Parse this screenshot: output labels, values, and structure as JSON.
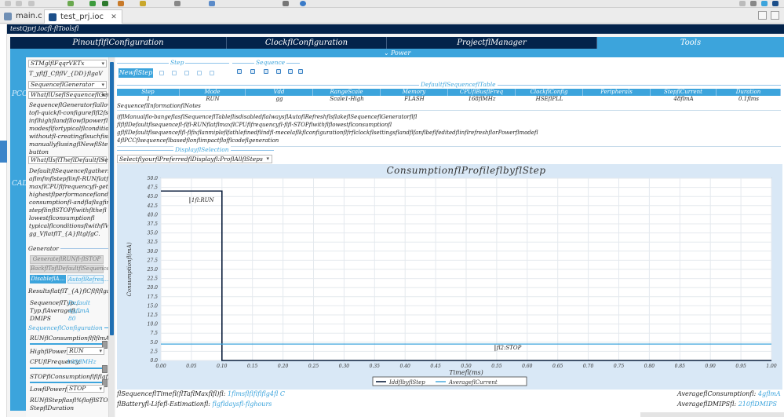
{
  "editor_tabs": [
    {
      "label": "main.c",
      "active": false
    },
    {
      "label": "test_prj.ioc",
      "active": true
    }
  ],
  "ioc_title": "testQprj.iocfl-flToolsfl",
  "main_tabs": [
    "PinoutflflConfiguration",
    "ClockflConfiguration",
    "ProjectflManager",
    "Tools"
  ],
  "power_label": "⌄ Power",
  "categories": [
    "PCC",
    "CAD"
  ],
  "left_panel": {
    "mcu_select": "STMglflFqqrVETx",
    "voltage_label": "T_yflfJ_CflflV_{DD}flgaV",
    "generator_select": "SequenceflGenerator",
    "what_select": "WhatflUseflSequenceflGener…",
    "gen_desc": [
      "SequenceflGeneratorflallowsfl",
      "tofl-quickfl-configureflfl2fsteps:",
      "inflhighflandfllowflpowerfl",
      "modesflfortypicalflconditionsfl",
      "withoutfl-creatingflsuchfistepsfl",
      "manuallyflusingflNewflStepfl",
      "button"
    ],
    "what_default_select": "WhatflIsflTheflDefaultflSequ…",
    "default_desc": [
      "DefaultflSequenceflgathersfl",
      "aflmfmflstepflinfl-RUNflatflhe",
      "maxflCPUflfrequencyfl-gettingfl",
      "highestflperformanceflandfl",
      "consumptionfl-andflaflsgfimstefl",
      "stepflinflSTOPflwithflthefl",
      "lowestflconsumptionfl",
      "typicalflconditionsflwithflV_{DD}fl",
      "gg_VflatflT_{A}fltglfgC."
    ],
    "generator_group": "Generator",
    "btn_generate": "GenerateflRUNfl-flSTOP",
    "btn_back": "BackflToflDefaultflSequence",
    "btn_disable": "DisableflA…",
    "btn_auto": "AutoflRefres…",
    "results_group": "ResultsflatflT_{A}flCflflflgaV…",
    "results": [
      {
        "label": "SequenceflTyp…",
        "value": "Default"
      },
      {
        "label": "Typ.flAveragefl…",
        "value": "4gflmA"
      },
      {
        "label": "DMIPS",
        "value": "80"
      }
    ],
    "seqconf_group": "SequenceflConfiguration",
    "run_consumption": "RUNflConsumptionflflflmA",
    "high_power_label": "HighflPowerflM…",
    "high_power_value": "RUN",
    "cpu_freq_label": "CPUflFrequency:",
    "cpu_freq_value": "168flMHz",
    "stop_consumption": "STOPflConsumptionflflflgfflA",
    "low_power_label": "LowflPowerflM…",
    "low_power_value": "STOP",
    "run_stop_ratio": "RUNflStepflasfl%flofflSTOPfl",
    "step_duration": "StepflDuration"
  },
  "step_section": "Step",
  "sequence_section": "Sequence",
  "new_step_button": "NewflStep",
  "default_table_title": "DefaultflSequenceflTable",
  "table": {
    "headers": [
      "Step",
      "Mode",
      "Vdd",
      "RangeScale",
      "Memory",
      "CPUflBusflFreq",
      "ClockflConfig",
      "Peripherals",
      "StepflCurrent",
      "Duration"
    ],
    "row": [
      "1",
      "RUN",
      "gg",
      "Scale1-High",
      "FLASH",
      "168flMHz",
      "HSEflPLL",
      "",
      "48flmA",
      "0.1flms"
    ]
  },
  "seq_info_label": "SequenceflInformationflNotes",
  "info_lines": [
    "ifflManualflo-bangeflasflSequenceflTableflisdisabledflalwaysflAutoflRefreshflsflakeflSequenceflGeneratorflfl",
    "flflflDefaultflsequencefl-flfl-RUNflatflmaxflCPUflfrequencyfl-flfl-STOPflwithflflowestflconsumptionfl",
    "gflflDefaultflsequenceflfl-flfixflanmipleflfathlefinedflindfl-mecelaflkflconfigurationflfrflclockflsettingsflandflfanflbeflfeditedflinflrefreshflorPowerflmodefl",
    "4flPCCflsequenceflbasedflonflimpactflofflcodeflgeneration"
  ],
  "display_section": "DisplayflSelection",
  "display_select": "SelectflyourflPreferredflDisplayfl:ProflAllflSteps",
  "chart_data": {
    "type": "line",
    "title": "ConsumptionflProfileflbyflStep",
    "xlabel": "Timefl(ms)",
    "ylabel": "Consumptionfl(mA)",
    "xlim": [
      0.0,
      1.0
    ],
    "ylim": [
      0.0,
      50.0
    ],
    "x_ticks": [
      "0.00",
      "0.05",
      "0.10",
      "0.15",
      "0.20",
      "0.25",
      "0.30",
      "0.35",
      "0.40",
      "0.45",
      "0.50",
      "0.55",
      "0.60",
      "0.65",
      "0.70",
      "0.75",
      "0.80",
      "0.85",
      "0.90",
      "0.95",
      "1.00"
    ],
    "y_ticks": [
      "0.0",
      "2.5",
      "5.0",
      "7.5",
      "10.0",
      "12.5",
      "15.0",
      "17.5",
      "20.0",
      "22.5",
      "25.0",
      "27.5",
      "30.0",
      "32.5",
      "35.0",
      "37.5",
      "40.0",
      "42.5",
      "45.0",
      "47.5",
      "50.0"
    ],
    "series": [
      {
        "name": "IddflbyflStep",
        "color": "#0b1e3c",
        "points": [
          [
            0.0,
            46.5
          ],
          [
            0.1,
            46.5
          ],
          [
            0.1,
            0.0
          ],
          [
            1.0,
            0.0
          ]
        ]
      },
      {
        "name": "AverageflCurrent",
        "color": "#3ca4dc",
        "points": [
          [
            0.0,
            4.5
          ],
          [
            1.0,
            4.5
          ]
        ]
      }
    ],
    "annotations": [
      {
        "text": "1fl:RUN",
        "x": 0.05,
        "y": 43.5
      },
      {
        "text": "fl2:STOP",
        "x": 0.55,
        "y": 3.0
      }
    ],
    "legend_position": "bottom",
    "grid": true
  },
  "stats": {
    "seq_time_label": "flSequenceflTimefl(flTaflMaxflfl)fl:",
    "seq_time_value": "1flmsflflflflflg4fl C",
    "battery_label": "flBatteryfl-Lifefl-Estimationfl:",
    "battery_value": "flgfldaysfl-flghours",
    "avg_consumption_label": "AverageflConsumptionfl:",
    "avg_consumption_value": "4gflmA",
    "avg_dmips_label": "AverageflDMIPSfl:",
    "avg_dmips_value": "210flDMIPS"
  }
}
